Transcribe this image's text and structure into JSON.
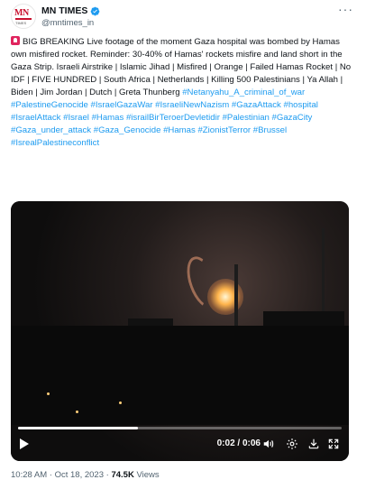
{
  "author": {
    "name": "MN TIMES",
    "handle": "@mntimes_in",
    "avatar_text": "MN",
    "avatar_subtext": "TIMES"
  },
  "tweet": {
    "text": "BIG BREAKING Live footage of the moment Gaza hospital was bombed by Hamas own misfired rocket. Reminder: 30-40% of Hamas' rockets misfire and land short in the Gaza Strip.   Israeli Airstrike | Islamic Jihad | Misfired | Orange | Failed Hamas Rocket | No IDF | FIVE HUNDRED | South Africa | Netherlands | Killing 500 Palestinians | Ya Allah | Biden | Jim Jordan | Dutch | Greta Thunberg",
    "hashtags": "#Netanyahu_A_criminal_of_war #PalestineGenocide #IsraelGazaWar #IsraeliNewNazism #GazaAttack #hospital #IsraelAttack #Israel #Hamas #israilBirTeroerDevletidir #Palestinian #GazaCity #Gaza_under_attack #Gaza_Genocide #Hamas #ZionistTerror #Brussel #IsrealPalestineconflict"
  },
  "video": {
    "current_time": "0:02",
    "duration": "0:06",
    "time_display": "0:02 / 0:06",
    "progress_fraction": 0.37
  },
  "meta": {
    "time": "10:28 AM",
    "date": "Oct 18, 2023",
    "views_count": "74.5K",
    "views_label": "Views"
  },
  "colors": {
    "accent": "#1d9bf0",
    "text": "#0f1419",
    "muted": "#536471",
    "alert": "#e0245e"
  },
  "icons": [
    "more-options-icon",
    "verified-badge-icon",
    "alarm-icon",
    "play-icon",
    "volume-icon",
    "settings-icon",
    "download-icon",
    "fullscreen-icon"
  ]
}
